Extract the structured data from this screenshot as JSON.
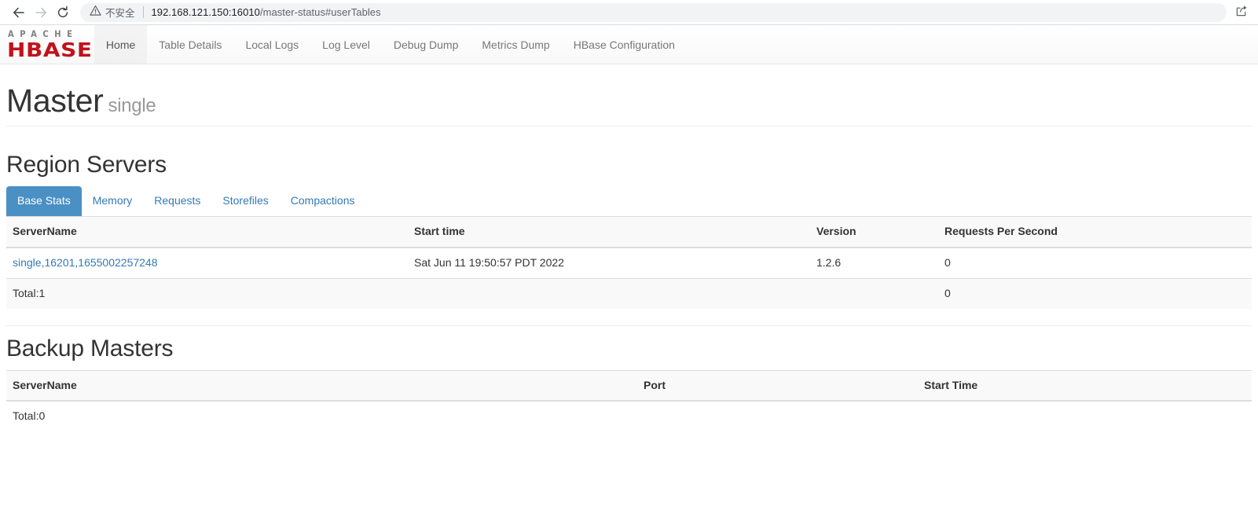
{
  "browser": {
    "back_icon": "back-arrow-icon",
    "forward_icon": "forward-arrow-icon",
    "reload_icon": "reload-icon",
    "security_icon": "warning-triangle-icon",
    "security_label": "不安全",
    "url_host": "192.168.121.150:16010",
    "url_path": "/master-status#userTables",
    "url_full": "192.168.121.150:16010/master-status#userTables",
    "share_icon": "share-export-icon"
  },
  "navbar": {
    "brand_top": "APACHE",
    "brand_main": "HBASE",
    "items": [
      {
        "label": "Home",
        "active": true
      },
      {
        "label": "Table Details",
        "active": false
      },
      {
        "label": "Local Logs",
        "active": false
      },
      {
        "label": "Log Level",
        "active": false
      },
      {
        "label": "Debug Dump",
        "active": false
      },
      {
        "label": "Metrics Dump",
        "active": false
      },
      {
        "label": "HBase Configuration",
        "active": false
      }
    ]
  },
  "page": {
    "title": "Master",
    "subtitle": "single"
  },
  "region_servers": {
    "heading": "Region Servers",
    "tabs": [
      {
        "label": "Base Stats",
        "active": true
      },
      {
        "label": "Memory",
        "active": false
      },
      {
        "label": "Requests",
        "active": false
      },
      {
        "label": "Storefiles",
        "active": false
      },
      {
        "label": "Compactions",
        "active": false
      }
    ],
    "columns": [
      "ServerName",
      "Start time",
      "Version",
      "Requests Per Second"
    ],
    "rows": [
      {
        "server_name": "single,16201,1655002257248",
        "start_time": "Sat Jun 11 19:50:57 PDT 2022",
        "version": "1.2.6",
        "requests_per_second": "0"
      }
    ],
    "total_row": {
      "server_name": "Total:1",
      "start_time": "",
      "version": "",
      "requests_per_second": "0"
    }
  },
  "backup_masters": {
    "heading": "Backup Masters",
    "columns": [
      "ServerName",
      "Port",
      "Start Time"
    ],
    "rows": [],
    "total_row": {
      "server_name": "Total:0",
      "port": "",
      "start_time": ""
    }
  },
  "colors": {
    "brand_red": "#c1121c",
    "link_blue": "#337ab7",
    "active_tab_blue": "#4a90c4",
    "table_stripe": "#f9f9f9",
    "border_gray": "#dddddd"
  }
}
